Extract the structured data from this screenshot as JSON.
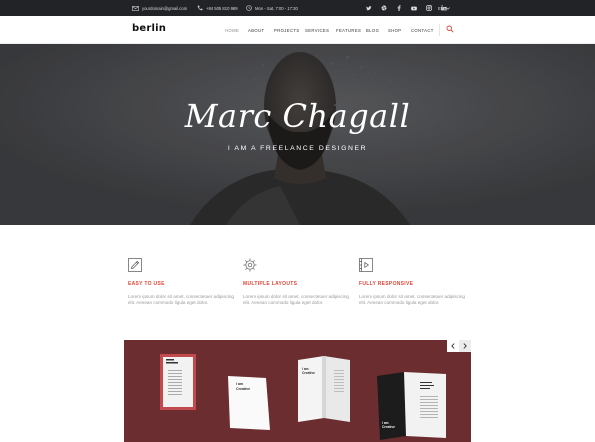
{
  "topbar": {
    "email": "yourdomain@gmail.com",
    "phone": "+84 505 810 989",
    "hours": "Mon - Sat, 7:00 - 17:30",
    "social_icons": [
      "twitter-icon",
      "dribbble-icon",
      "facebook-icon",
      "youtube-icon",
      "instagram-icon",
      "linkedin-icon"
    ],
    "language": "EN"
  },
  "header": {
    "logo": "berlin",
    "nav": [
      "HOME",
      "ABOUT",
      "PROJECTS",
      "SERVICES",
      "FEATURES",
      "BLOG",
      "SHOP",
      "CONTACT"
    ]
  },
  "hero": {
    "name": "Marc Chagall",
    "subtitle": "I AM A FREELANCE DESIGNER"
  },
  "features": [
    {
      "icon": "pencil-icon",
      "title": "EASY TO USE",
      "text": "Lorem ipsum dolor sit amet, consectetuer adipiscing elit. Aenean commodo ligula eget dolor."
    },
    {
      "icon": "target-icon",
      "title": "MULTIPLE LAYOUTS",
      "text": "Lorem ipsum dolor sit amet, consectetuer adipiscing elit. Aenean commodo ligula eget dolor."
    },
    {
      "icon": "video-icon",
      "title": "FULLY RESPONSIVE",
      "text": "Lorem ipsum dolor sit amet, consectetuer adipiscing elit. Aenean commodo ligula eget dolor."
    }
  ],
  "showcase": {
    "book_label_lines": [
      "I am",
      "Creative"
    ],
    "colors": {
      "background": "#6b2d2f",
      "accent": "#e0473a"
    }
  }
}
